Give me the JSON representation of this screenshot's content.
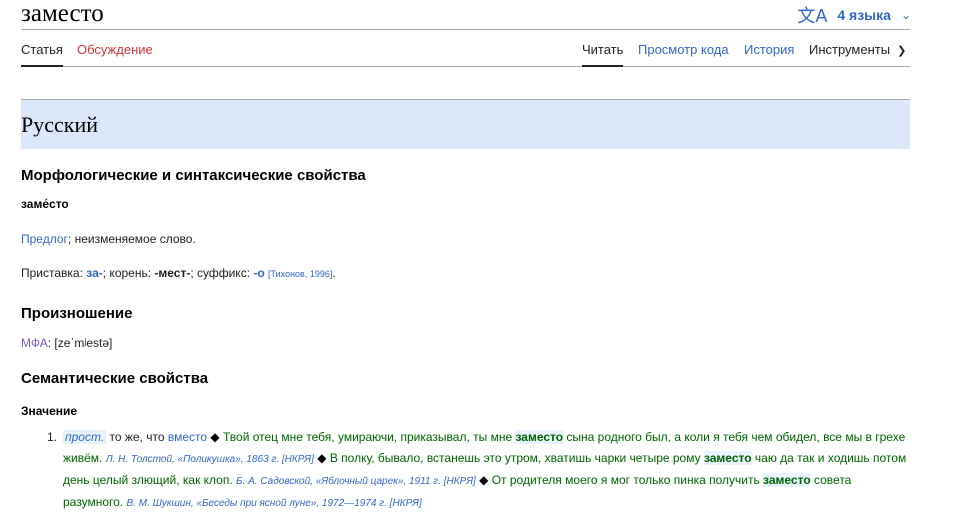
{
  "page": {
    "title": "заместо",
    "languages_label": "4 языка",
    "lang_icon": "translate-icon"
  },
  "tabs": {
    "article": "Статья",
    "talk": "Обсуждение",
    "read": "Читать",
    "source": "Просмотр кода",
    "history": "История",
    "tools": "Инструменты"
  },
  "section": {
    "language": "Русский",
    "morph_heading": "Морфологические и синтаксические свойства",
    "headword": "заме́сто",
    "pos_link": "Предлог",
    "pos_rest": "; неизменяемое слово.",
    "morph_prefix_label": "Приставка: ",
    "morph_prefix": "за-",
    "morph_root_label": "; корень: ",
    "morph_root": "-мест-",
    "morph_suffix_label": "; суффикс: ",
    "morph_suffix": "-о",
    "morph_source": "[Тихонов, 1996]",
    "pron_heading": "Произношение",
    "ipa_label": "МФА",
    "ipa_value": ": [zeˈmʲestə]",
    "sem_heading": "Семантические свойства",
    "meaning_heading": "Значение"
  },
  "meaning": {
    "number": "1.",
    "tag": "прост.",
    "def_start": " то же, что ",
    "def_link": "вместо",
    "ex1_before": "Твой отец мне тебя, умираючи, приказывал, ты мне ",
    "ex1_bold": "заместо",
    "ex1_after": " сына родного был, а коли я тебя чем обидел, все мы в грехе живём.",
    "src1": "Л. Н. Толстой, «Поликушка», 1863 г. [НКРЯ]",
    "ex2_before": "В полку, бывало, встанешь это утром, хватишь чарки четыре рому ",
    "ex2_bold": "заместо",
    "ex2_after": " чаю да так и ходишь потом день целый злющий, как клоп.",
    "src2": "Б. А. Садовской, «Яблочный царек», 1911 г. [НКРЯ]",
    "ex3_before": "От родителя моего я мог только пинка получить ",
    "ex3_bold": "заместо",
    "ex3_after": " совета разумного.",
    "src3": "В. М. Шукшин, «Беседы при ясной луне», 1972—1974 г. [НКРЯ]",
    "separator": "◆"
  }
}
